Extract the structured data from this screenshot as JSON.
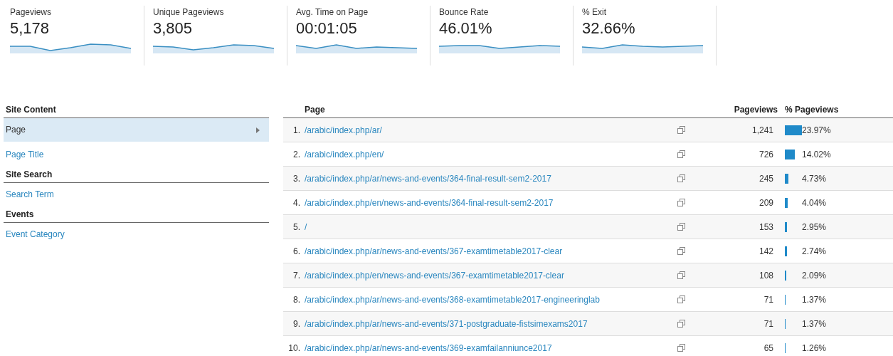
{
  "metrics": [
    {
      "label": "Pageviews",
      "value": "5,178"
    },
    {
      "label": "Unique Pageviews",
      "value": "3,805"
    },
    {
      "label": "Avg. Time on Page",
      "value": "00:01:05"
    },
    {
      "label": "Bounce Rate",
      "value": "46.01%"
    },
    {
      "label": "% Exit",
      "value": "32.66%"
    }
  ],
  "sidebar": {
    "groups": [
      {
        "heading": "Site Content",
        "items": [
          {
            "label": "Page",
            "selected": true
          },
          {
            "label": "Page Title",
            "selected": false
          }
        ]
      },
      {
        "heading": "Site Search",
        "items": [
          {
            "label": "Search Term",
            "selected": false
          }
        ]
      },
      {
        "heading": "Events",
        "items": [
          {
            "label": "Event Category",
            "selected": false
          }
        ]
      }
    ]
  },
  "table": {
    "columns": [
      "Page",
      "Pageviews",
      "% Pageviews"
    ],
    "rows": [
      {
        "index": "1.",
        "page": "/arabic/index.php/ar/",
        "pageviews": "1,241",
        "percent": "23.97%"
      },
      {
        "index": "2.",
        "page": "/arabic/index.php/en/",
        "pageviews": "726",
        "percent": "14.02%"
      },
      {
        "index": "3.",
        "page": "/arabic/index.php/ar/news-and-events/364-final-result-sem2-2017",
        "pageviews": "245",
        "percent": "4.73%"
      },
      {
        "index": "4.",
        "page": "/arabic/index.php/en/news-and-events/364-final-result-sem2-2017",
        "pageviews": "209",
        "percent": "4.04%"
      },
      {
        "index": "5.",
        "page": "/",
        "pageviews": "153",
        "percent": "2.95%"
      },
      {
        "index": "6.",
        "page": "/arabic/index.php/ar/news-and-events/367-examtimetable2017-clear",
        "pageviews": "142",
        "percent": "2.74%"
      },
      {
        "index": "7.",
        "page": "/arabic/index.php/en/news-and-events/367-examtimetable2017-clear",
        "pageviews": "108",
        "percent": "2.09%"
      },
      {
        "index": "8.",
        "page": "/arabic/index.php/ar/news-and-events/368-examtimetable2017-engineeringlab",
        "pageviews": "71",
        "percent": "1.37%"
      },
      {
        "index": "9.",
        "page": "/arabic/index.php/ar/news-and-events/371-postgraduate-fistsimexams2017",
        "pageviews": "71",
        "percent": "1.37%"
      },
      {
        "index": "10.",
        "page": "/arabic/index.php/ar/news-and-events/369-examfailanniunce2017",
        "pageviews": "65",
        "percent": "1.26%"
      }
    ]
  }
}
